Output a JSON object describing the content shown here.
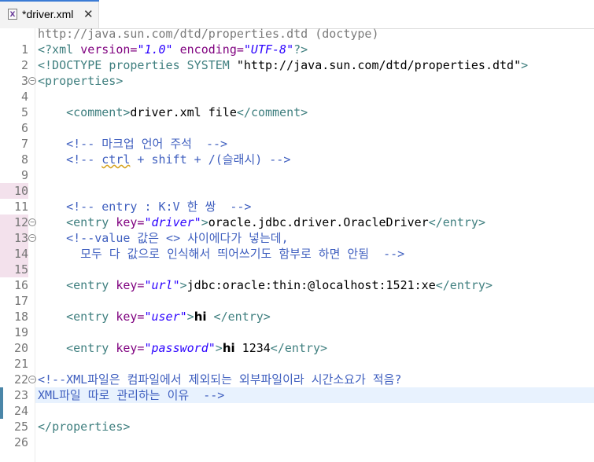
{
  "tab": {
    "title": "*driver.xml",
    "close": "✕",
    "icon": "xml-file-icon",
    "icon_text": "X"
  },
  "doctype_hint": "http://java.sun.com/dtd/properties.dtd (doctype)",
  "line_numbers": [
    "1",
    "2",
    "3",
    "4",
    "5",
    "6",
    "7",
    "8",
    "9",
    "10",
    "11",
    "12",
    "13",
    "14",
    "15",
    "16",
    "17",
    "18",
    "19",
    "20",
    "21",
    "22",
    "23",
    "24",
    "25",
    "26"
  ],
  "code": {
    "l1": [
      "<?xml ",
      "version=",
      "\"1.0\"",
      " encoding=",
      "\"UTF-8\"",
      "?>"
    ],
    "l2": [
      "<!DOCTYPE ",
      "properties",
      " SYSTEM ",
      "\"http://java.sun.com/dtd/properties.dtd\"",
      ">"
    ],
    "l3": [
      "<",
      "properties",
      ">"
    ],
    "l5": [
      "    <",
      "comment",
      ">",
      "driver.xml file",
      "</",
      "comment",
      ">"
    ],
    "l7": "    <!-- 마크업 언어 주석  -->",
    "l8": [
      "    <!-- ",
      "ctrl",
      " + shift + /(슬래시) -->"
    ],
    "l11": "    <!-- entry : K:V 한 쌍  -->",
    "l12": [
      "    <",
      "entry",
      " key=",
      "\"driver\"",
      ">",
      "oracle.jdbc.driver.OracleDriver",
      "</",
      "entry",
      ">"
    ],
    "l13": "    <!--value 값은 <> 사이에다가 넣는데,",
    "l14": "      모두 다 값으로 인식해서 띄어쓰기도 함부로 하면 안됨  -->",
    "l16": [
      "    <",
      "entry",
      " key=",
      "\"url\"",
      ">",
      "jdbc:oracle:thin:@localhost:1521:xe",
      "</",
      "entry",
      ">"
    ],
    "l18": [
      "    <",
      "entry",
      " key=",
      "\"user\"",
      ">",
      "hi",
      " </",
      "entry",
      ">"
    ],
    "l20": [
      "    <",
      "entry",
      " key=",
      "\"password\"",
      ">",
      "hi",
      " 1234",
      "</",
      "entry",
      ">"
    ],
    "l22": "<!--XML파일은 컴파일에서 제외되는 외부파일이라 시간소요가 적음?",
    "l23": "XML파일 따로 관리하는 이유  -->",
    "l25": [
      "</",
      "properties",
      ">"
    ]
  },
  "colors": {
    "tag": "#3f7f7f",
    "attr": "#7f007f",
    "value": "#2a00ff",
    "comment": "#3f5fbf",
    "highlight": "#e8f2fe",
    "tab_accent": "#3a7bd5"
  }
}
